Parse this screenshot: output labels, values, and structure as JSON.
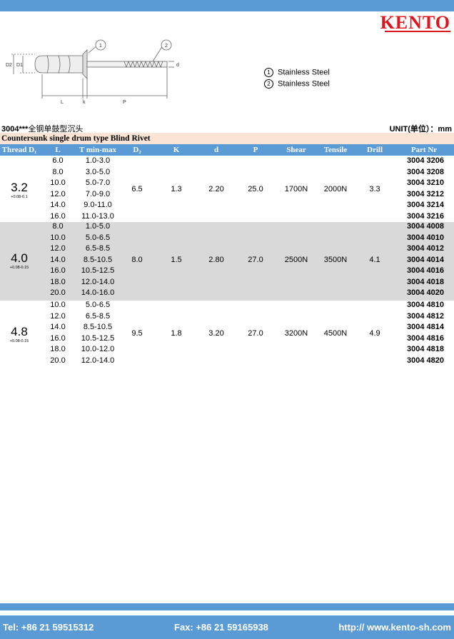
{
  "brand": "KENTO",
  "legend": [
    {
      "num": "①",
      "label": "Stainless Steel"
    },
    {
      "num": "②",
      "label": "Stainless Steel"
    }
  ],
  "drawing_labels": {
    "callout1": "1",
    "callout2": "2",
    "D2": "D2",
    "D1": "D1",
    "L": "L",
    "k": "k",
    "P": "P",
    "d": "d"
  },
  "model": {
    "code": "3004***",
    "name_cn": "全钢单鼓型沉头"
  },
  "unit": "UNIT(单位）：mm",
  "type_title": "Countersunk single drum type Blind Rivet",
  "headers": {
    "thread": "Thread D₁",
    "L": "L",
    "T": "T min-max",
    "D2": "D₂",
    "K": "K",
    "d": "d",
    "P": "P",
    "shear": "Shear",
    "tensile": "Tensile",
    "drill": "Drill",
    "part": "Part Nr"
  },
  "groups": [
    {
      "dia": "3.2",
      "tol": "+0.08-0.1",
      "D2": "6.5",
      "K": "1.3",
      "d": "2.20",
      "P": "25.0",
      "shear": "1700N",
      "tensile": "2000N",
      "drill": "3.3",
      "rows": [
        {
          "L": "6.0",
          "T": "1.0-3.0",
          "part": "3004 3206"
        },
        {
          "L": "8.0",
          "T": "3.0-5.0",
          "part": "3004 3208"
        },
        {
          "L": "10.0",
          "T": "5.0-7.0",
          "part": "3004 3210"
        },
        {
          "L": "12.0",
          "T": "7.0-9.0",
          "part": "3004 3212"
        },
        {
          "L": "14.0",
          "T": "9.0-11.0",
          "part": "3004 3214"
        },
        {
          "L": "16.0",
          "T": "11.0-13.0",
          "part": "3004 3216"
        }
      ]
    },
    {
      "dia": "4.0",
      "tol": "+0.08-0.15",
      "D2": "8.0",
      "K": "1.5",
      "d": "2.80",
      "P": "27.0",
      "shear": "2500N",
      "tensile": "3500N",
      "drill": "4.1",
      "rows": [
        {
          "L": "8.0",
          "T": "1.0-5.0",
          "part": "3004 4008"
        },
        {
          "L": "10.0",
          "T": "5.0-6.5",
          "part": "3004 4010"
        },
        {
          "L": "12.0",
          "T": "6.5-8.5",
          "part": "3004 4012"
        },
        {
          "L": "14.0",
          "T": "8.5-10.5",
          "part": "3004 4014"
        },
        {
          "L": "16.0",
          "T": "10.5-12.5",
          "part": "3004 4016"
        },
        {
          "L": "18.0",
          "T": "12.0-14.0",
          "part": "3004 4018"
        },
        {
          "L": "20.0",
          "T": "14.0-16.0",
          "part": "3004 4020"
        }
      ]
    },
    {
      "dia": "4.8",
      "tol": "+0.08-0.15",
      "D2": "9.5",
      "K": "1.8",
      "d": "3.20",
      "P": "27.0",
      "shear": "3200N",
      "tensile": "4500N",
      "drill": "4.9",
      "rows": [
        {
          "L": "10.0",
          "T": "5.0-6.5",
          "part": "3004 4810"
        },
        {
          "L": "12.0",
          "T": "6.5-8.5",
          "part": "3004 4812"
        },
        {
          "L": "14.0",
          "T": "8.5-10.5",
          "part": "3004 4814"
        },
        {
          "L": "16.0",
          "T": "10.5-12.5",
          "part": "3004 4816"
        },
        {
          "L": "18.0",
          "T": "10.0-12.0",
          "part": "3004 4818"
        },
        {
          "L": "20.0",
          "T": "12.0-14.0",
          "part": "3004 4820"
        }
      ]
    }
  ],
  "footer": {
    "tel": "Tel: +86 21 59515312",
    "fax": "Fax: +86 21 59165938",
    "web": "http:// www.kento-sh.com"
  }
}
